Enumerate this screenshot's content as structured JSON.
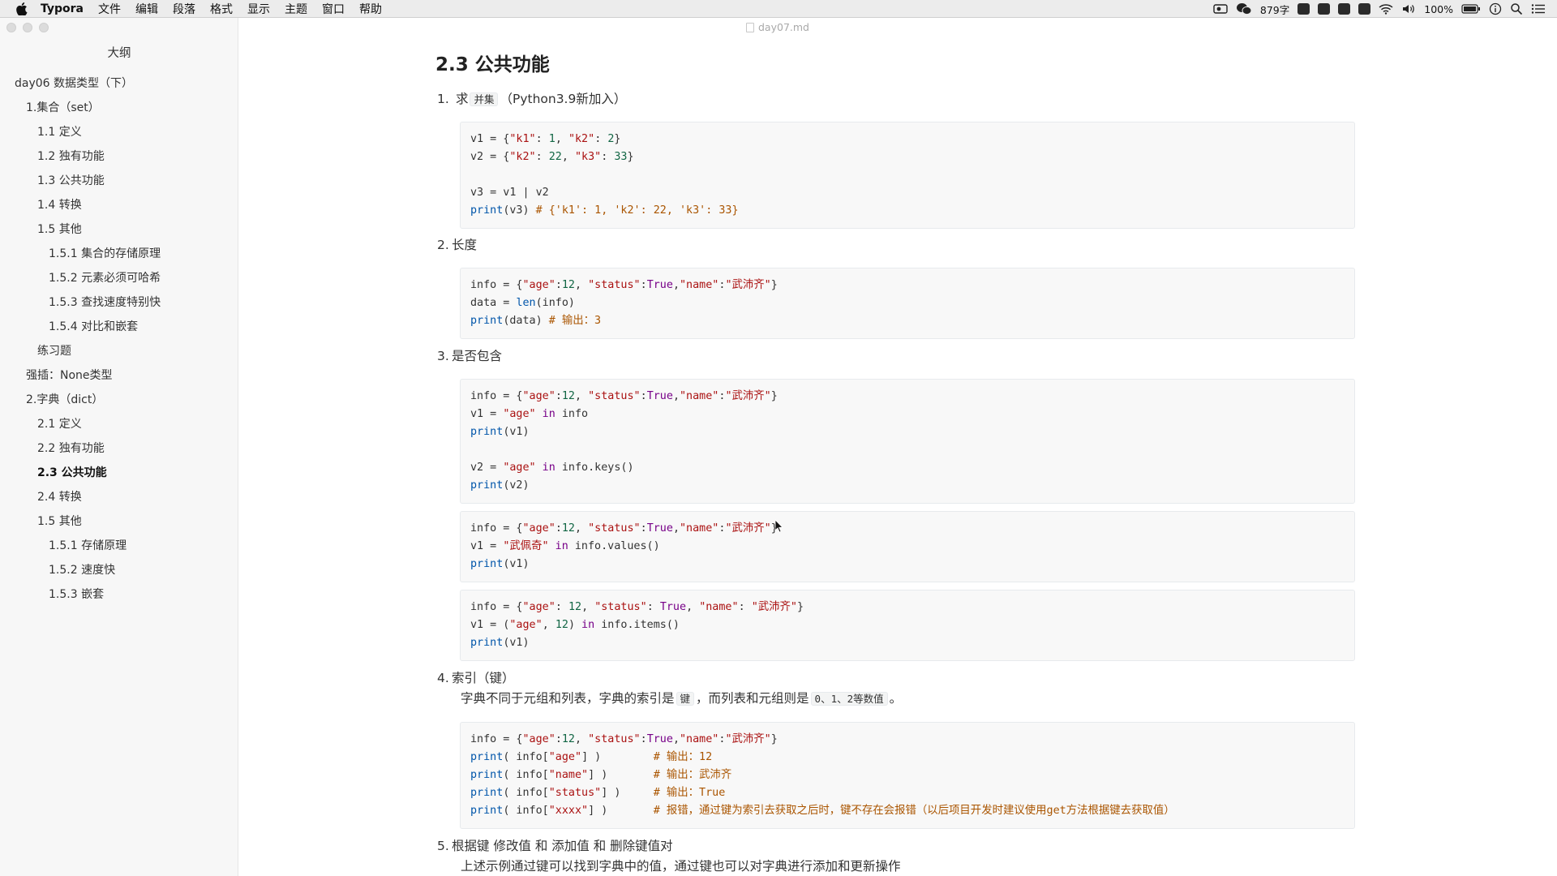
{
  "menubar": {
    "app_name": "Typora",
    "items": [
      "文件",
      "编辑",
      "段落",
      "格式",
      "显示",
      "主题",
      "窗口",
      "帮助"
    ],
    "word_count": "879字",
    "battery": "100%"
  },
  "window": {
    "file_name": "day07.md"
  },
  "sidebar": {
    "title": "大纲",
    "items": [
      {
        "label": "day06 数据类型（下）",
        "level": 1
      },
      {
        "label": "1.集合（set）",
        "level": 2
      },
      {
        "label": "1.1 定义",
        "level": 3
      },
      {
        "label": "1.2 独有功能",
        "level": 3
      },
      {
        "label": "1.3 公共功能",
        "level": 3
      },
      {
        "label": "1.4 转换",
        "level": 3
      },
      {
        "label": "1.5 其他",
        "level": 3
      },
      {
        "label": "1.5.1 集合的存储原理",
        "level": 4
      },
      {
        "label": "1.5.2 元素必须可哈希",
        "level": 4
      },
      {
        "label": "1.5.3 查找速度特别快",
        "level": 4
      },
      {
        "label": "1.5.4 对比和嵌套",
        "level": 4
      },
      {
        "label": "练习题",
        "level": 3
      },
      {
        "label": "强插：None类型",
        "level": 2
      },
      {
        "label": "2.字典（dict）",
        "level": 2
      },
      {
        "label": "2.1 定义",
        "level": 3
      },
      {
        "label": "2.2 独有功能",
        "level": 3
      },
      {
        "label": "2.3 公共功能",
        "level": 3,
        "active": true
      },
      {
        "label": "2.4 转换",
        "level": 3
      },
      {
        "label": "1.5 其他",
        "level": 3
      },
      {
        "label": "1.5.1 存储原理",
        "level": 4
      },
      {
        "label": "1.5.2 速度快",
        "level": 4
      },
      {
        "label": "1.5.3 嵌套",
        "level": 4
      }
    ]
  },
  "doc": {
    "heading": "2.3 公共功能",
    "items": [
      {
        "num": "1.",
        "pre": "求",
        "code": "并集",
        "post": "（Python3.9新加入）"
      },
      {
        "num": "2.",
        "text": "长度"
      },
      {
        "num": "3.",
        "text": "是否包含"
      },
      {
        "num": "4.",
        "text": "索引（键）"
      },
      {
        "num": "5.",
        "text": "根据键 修改值 和 添加值 和 删除键值对"
      }
    ],
    "para4": {
      "a": "字典不同于元组和列表，字典的索引是",
      "code1": "键",
      "b": "，而列表和元组则是",
      "code2": "0、1、2等数值",
      "c": "。"
    },
    "para5": "上述示例通过键可以找到字典中的值，通过键也可以对字典进行添加和更新操作",
    "blocks": [
      [
        [
          [
            "v1 = {",
            "t"
          ],
          [
            "\"k1\"",
            "s"
          ],
          [
            ": ",
            "t"
          ],
          [
            "1",
            "n"
          ],
          [
            ", ",
            "t"
          ],
          [
            "\"k2\"",
            "s"
          ],
          [
            ": ",
            "t"
          ],
          [
            "2",
            "n"
          ],
          [
            "}",
            "t"
          ]
        ],
        [
          [
            "v2 = {",
            "t"
          ],
          [
            "\"k2\"",
            "s"
          ],
          [
            ": ",
            "t"
          ],
          [
            "22",
            "n"
          ],
          [
            ", ",
            "t"
          ],
          [
            "\"k3\"",
            "s"
          ],
          [
            ": ",
            "t"
          ],
          [
            "33",
            "n"
          ],
          [
            "}",
            "t"
          ]
        ],
        [],
        [
          [
            "v3 = v1 | v2",
            "t"
          ]
        ],
        [
          [
            "print",
            "b"
          ],
          [
            "(v3) ",
            "t"
          ],
          [
            "# {'k1': 1, 'k2': 22, 'k3': 33}",
            "c"
          ]
        ]
      ],
      [
        [
          [
            "info = {",
            "t"
          ],
          [
            "\"age\"",
            "s"
          ],
          [
            ":",
            "t"
          ],
          [
            "12",
            "n"
          ],
          [
            ", ",
            "t"
          ],
          [
            "\"status\"",
            "s"
          ],
          [
            ":",
            "t"
          ],
          [
            "True",
            "k"
          ],
          [
            ",",
            "t"
          ],
          [
            "\"name\"",
            "s"
          ],
          [
            ":",
            "t"
          ],
          [
            "\"武沛齐\"",
            "s"
          ],
          [
            "}",
            "t"
          ]
        ],
        [
          [
            "data = ",
            "t"
          ],
          [
            "len",
            "b"
          ],
          [
            "(info)",
            "t"
          ]
        ],
        [
          [
            "print",
            "b"
          ],
          [
            "(data) ",
            "t"
          ],
          [
            "# 输出：3",
            "c"
          ]
        ]
      ],
      [
        [
          [
            "info = {",
            "t"
          ],
          [
            "\"age\"",
            "s"
          ],
          [
            ":",
            "t"
          ],
          [
            "12",
            "n"
          ],
          [
            ", ",
            "t"
          ],
          [
            "\"status\"",
            "s"
          ],
          [
            ":",
            "t"
          ],
          [
            "True",
            "k"
          ],
          [
            ",",
            "t"
          ],
          [
            "\"name\"",
            "s"
          ],
          [
            ":",
            "t"
          ],
          [
            "\"武沛齐\"",
            "s"
          ],
          [
            "}",
            "t"
          ]
        ],
        [
          [
            "v1 = ",
            "t"
          ],
          [
            "\"age\"",
            "s"
          ],
          [
            " in ",
            "k"
          ],
          [
            "info",
            "t"
          ]
        ],
        [
          [
            "print",
            "b"
          ],
          [
            "(v1)",
            "t"
          ]
        ],
        [],
        [
          [
            "v2 = ",
            "t"
          ],
          [
            "\"age\"",
            "s"
          ],
          [
            " in ",
            "k"
          ],
          [
            "info.keys()",
            "t"
          ]
        ],
        [
          [
            "print",
            "b"
          ],
          [
            "(v2)",
            "t"
          ]
        ]
      ],
      [
        [
          [
            "info = {",
            "t"
          ],
          [
            "\"age\"",
            "s"
          ],
          [
            ":",
            "t"
          ],
          [
            "12",
            "n"
          ],
          [
            ", ",
            "t"
          ],
          [
            "\"status\"",
            "s"
          ],
          [
            ":",
            "t"
          ],
          [
            "True",
            "k"
          ],
          [
            ",",
            "t"
          ],
          [
            "\"name\"",
            "s"
          ],
          [
            ":",
            "t"
          ],
          [
            "\"武沛齐\"",
            "s"
          ],
          [
            "}",
            "t"
          ]
        ],
        [
          [
            "v1 = ",
            "t"
          ],
          [
            "\"武佩奇\"",
            "s"
          ],
          [
            " in ",
            "k"
          ],
          [
            "info.values()",
            "t"
          ]
        ],
        [
          [
            "print",
            "b"
          ],
          [
            "(v1)",
            "t"
          ]
        ]
      ],
      [
        [
          [
            "info = {",
            "t"
          ],
          [
            "\"age\"",
            "s"
          ],
          [
            ": ",
            "t"
          ],
          [
            "12",
            "n"
          ],
          [
            ", ",
            "t"
          ],
          [
            "\"status\"",
            "s"
          ],
          [
            ": ",
            "t"
          ],
          [
            "True",
            "k"
          ],
          [
            ", ",
            "t"
          ],
          [
            "\"name\"",
            "s"
          ],
          [
            ": ",
            "t"
          ],
          [
            "\"武沛齐\"",
            "s"
          ],
          [
            "}",
            "t"
          ]
        ],
        [
          [
            "v1 = (",
            "t"
          ],
          [
            "\"age\"",
            "s"
          ],
          [
            ", ",
            "t"
          ],
          [
            "12",
            "n"
          ],
          [
            ")",
            "t"
          ],
          [
            " in ",
            "k"
          ],
          [
            "info.items()",
            "t"
          ]
        ],
        [
          [
            "print",
            "b"
          ],
          [
            "(v1)",
            "t"
          ]
        ]
      ],
      [
        [
          [
            "info = {",
            "t"
          ],
          [
            "\"age\"",
            "s"
          ],
          [
            ":",
            "t"
          ],
          [
            "12",
            "n"
          ],
          [
            ", ",
            "t"
          ],
          [
            "\"status\"",
            "s"
          ],
          [
            ":",
            "t"
          ],
          [
            "True",
            "k"
          ],
          [
            ",",
            "t"
          ],
          [
            "\"name\"",
            "s"
          ],
          [
            ":",
            "t"
          ],
          [
            "\"武沛齐\"",
            "s"
          ],
          [
            "}",
            "t"
          ]
        ],
        [
          [
            "print",
            "b"
          ],
          [
            "( info[",
            "t"
          ],
          [
            "\"age\"",
            "s"
          ],
          [
            "] )        ",
            "t"
          ],
          [
            "# 输出：12",
            "c"
          ]
        ],
        [
          [
            "print",
            "b"
          ],
          [
            "( info[",
            "t"
          ],
          [
            "\"name\"",
            "s"
          ],
          [
            "] )       ",
            "t"
          ],
          [
            "# 输出：武沛齐",
            "c"
          ]
        ],
        [
          [
            "print",
            "b"
          ],
          [
            "( info[",
            "t"
          ],
          [
            "\"status\"",
            "s"
          ],
          [
            "] )     ",
            "t"
          ],
          [
            "# 输出：True",
            "c"
          ]
        ],
        [
          [
            "print",
            "b"
          ],
          [
            "( info[",
            "t"
          ],
          [
            "\"xxxx\"",
            "s"
          ],
          [
            "] )       ",
            "t"
          ],
          [
            "# 报错，通过键为索引去获取之后时，键不存在会报错（以后项目开发时建议使用get方法根据键去获取值）",
            "c"
          ]
        ]
      ]
    ]
  }
}
